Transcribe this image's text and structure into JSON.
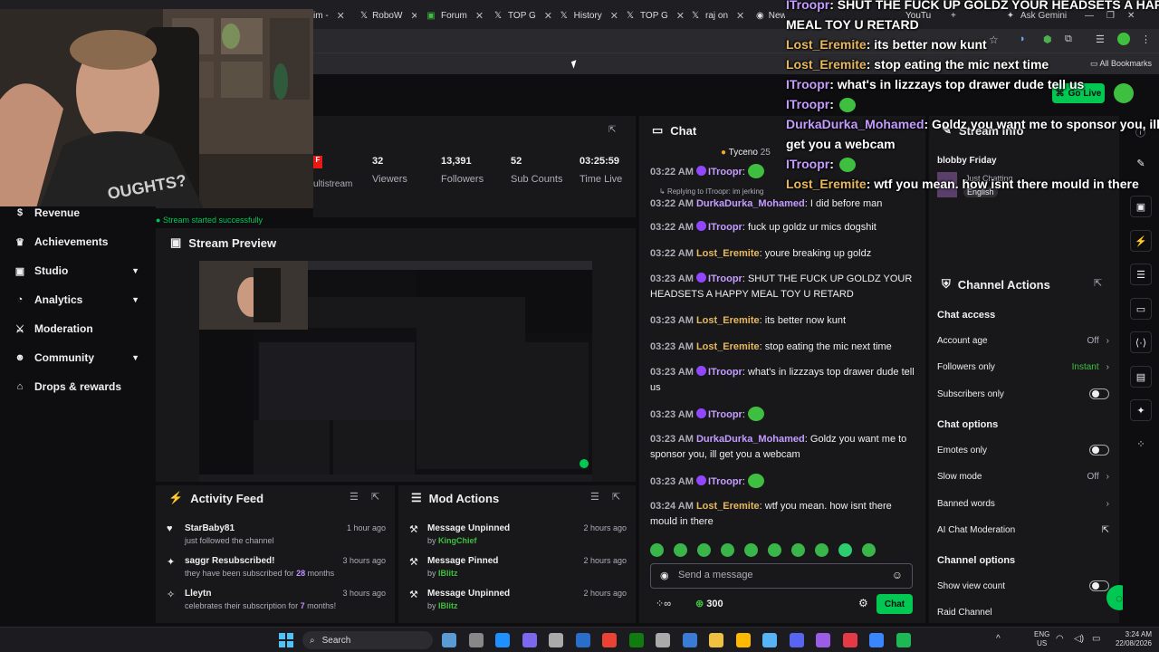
{
  "browser": {
    "tabs": [
      {
        "label": "im - "
      },
      {
        "label": "RoboW"
      },
      {
        "label": "Forum"
      },
      {
        "label": "TOP G"
      },
      {
        "label": "History"
      },
      {
        "label": "TOP G"
      },
      {
        "label": "raj on"
      },
      {
        "label": "New"
      },
      {
        "label": "YouTu"
      }
    ],
    "new_tab": "+",
    "ask_gemini": "Ask Gemini",
    "all_bookmarks": "All Bookmarks"
  },
  "header": {
    "go_live": "Go Live"
  },
  "sidebar": {
    "items": [
      {
        "label": "Revenue",
        "icon": "dollar-icon",
        "chevron": false
      },
      {
        "label": "Achievements",
        "icon": "trophy-icon",
        "chevron": false
      },
      {
        "label": "Studio",
        "icon": "studio-icon",
        "chevron": true
      },
      {
        "label": "Analytics",
        "icon": "chart-icon",
        "chevron": true
      },
      {
        "label": "Moderation",
        "icon": "sword-icon",
        "chevron": false
      },
      {
        "label": "Community",
        "icon": "community-icon",
        "chevron": true
      },
      {
        "label": "Drops & rewards",
        "icon": "gift-icon",
        "chevron": false
      }
    ]
  },
  "stats": {
    "multistream_label": "ultistream",
    "items": [
      {
        "value": "32",
        "label": "Viewers"
      },
      {
        "value": "13,391",
        "label": "Followers"
      },
      {
        "value": "52",
        "label": "Sub Counts"
      },
      {
        "value": "03:25:59",
        "label": "Time Live"
      }
    ],
    "status": "Stream started successfully"
  },
  "preview": {
    "title": "Stream Preview"
  },
  "activity": {
    "title": "Activity Feed",
    "rows": [
      {
        "title": "StarBaby81",
        "sub": "just followed the channel",
        "sub_bold": "",
        "sub_tail": "",
        "time": "1 hour ago",
        "icon": "heart-icon"
      },
      {
        "title": "saggr Resubscribed!",
        "sub": "they have been subscribed for ",
        "sub_bold": "28",
        "sub_tail": " months",
        "time": "3 hours ago",
        "icon": "star-icon"
      },
      {
        "title": "Lleytn",
        "sub": "celebrates their subscription for ",
        "sub_bold": "7",
        "sub_tail": " months!",
        "time": "3 hours ago",
        "icon": "sparkle-icon"
      }
    ]
  },
  "mod": {
    "title": "Mod Actions",
    "rows": [
      {
        "title": "Message Unpinned",
        "by": "by ",
        "user": "KingChief",
        "time": "2 hours ago"
      },
      {
        "title": "Message Pinned",
        "by": "by ",
        "user": "IBlitz",
        "time": "2 hours ago"
      },
      {
        "title": "Message Unpinned",
        "by": "by ",
        "user": "IBlitz",
        "time": "2 hours ago"
      }
    ]
  },
  "chat": {
    "title": "Chat",
    "pinned_user": "Tyceno",
    "pinned_count": "25",
    "reply_note": "Replying to ITroopr: im jerking",
    "messages": [
      {
        "time": "03:22 AM",
        "user": "ITroopr",
        "color": "#c59cff",
        "text": "",
        "emote": true
      },
      {
        "time": "03:22 AM",
        "user": "DurkaDurka_Mohamed",
        "color": "#c59cff",
        "text": "I did before man",
        "emote": false
      },
      {
        "time": "03:22 AM",
        "user": "ITroopr",
        "color": "#c59cff",
        "text": "fuck up goldz ur mics dogshit",
        "emote": false
      },
      {
        "time": "03:22 AM",
        "user": "Lost_Eremite",
        "color": "#e8b85f",
        "text": "youre breaking up goldz",
        "emote": false
      },
      {
        "time": "03:23 AM",
        "user": "ITroopr",
        "color": "#c59cff",
        "text": "SHUT THE FUCK UP GOLDZ YOUR HEADSETS A HAPPY MEAL TOY U RETARD",
        "emote": false
      },
      {
        "time": "03:23 AM",
        "user": "Lost_Eremite",
        "color": "#e8b85f",
        "text": "its better now kunt",
        "emote": false
      },
      {
        "time": "03:23 AM",
        "user": "Lost_Eremite",
        "color": "#e8b85f",
        "text": "stop eating the mic next time",
        "emote": false
      },
      {
        "time": "03:23 AM",
        "user": "ITroopr",
        "color": "#c59cff",
        "text": "what's in lizzzays top drawer dude tell us",
        "emote": false
      },
      {
        "time": "03:23 AM",
        "user": "ITroopr",
        "color": "#c59cff",
        "text": "",
        "emote": true
      },
      {
        "time": "03:23 AM",
        "user": "DurkaDurka_Mohamed",
        "color": "#c59cff",
        "text": "Goldz you want me to sponsor you, ill get you a webcam",
        "emote": false
      },
      {
        "time": "03:23 AM",
        "user": "ITroopr",
        "color": "#c59cff",
        "text": "",
        "emote": true
      },
      {
        "time": "03:24 AM",
        "user": "Lost_Eremite",
        "color": "#e8b85f",
        "text": "wtf you mean. how isnt there mould in there",
        "emote": false
      }
    ],
    "placeholder": "Send a message",
    "points": "300",
    "send_label": "Chat"
  },
  "info": {
    "title": "Stream Info",
    "stream_title": "blobby Friday",
    "category": "Just Chatting",
    "language": "English"
  },
  "actions": {
    "title": "Channel Actions",
    "chat_access": "Chat access",
    "account_age": {
      "label": "Account age",
      "value": "Off"
    },
    "followers_only": {
      "label": "Followers only",
      "value": "Instant"
    },
    "subscribers_only": {
      "label": "Subscribers only"
    },
    "chat_options": "Chat options",
    "emotes_only": {
      "label": "Emotes only"
    },
    "slow_mode": {
      "label": "Slow mode",
      "value": "Off"
    },
    "banned_words": {
      "label": "Banned words"
    },
    "ai_moderation": {
      "label": "AI Chat Moderation"
    },
    "channel_options": "Channel options",
    "show_view_count": {
      "label": "Show view count"
    },
    "raid_channel": {
      "label": "Raid Channel"
    }
  },
  "overlay": {
    "lines": [
      {
        "user": "ITroopr",
        "kind": "p",
        "text": ": SHUT THE FUCK UP GOLDZ YOUR HEADSETS A HAPPY"
      },
      {
        "user": "",
        "kind": "",
        "text": "MEAL TOY U RETARD"
      },
      {
        "user": "Lost_Eremite",
        "kind": "u",
        "text": ": its better now kunt"
      },
      {
        "user": "Lost_Eremite",
        "kind": "u",
        "text": ": stop eating the mic next time"
      },
      {
        "user": "ITroopr",
        "kind": "p",
        "text": ": what's in lizzzays top drawer dude tell us"
      },
      {
        "user": "ITroopr",
        "kind": "p",
        "text": ":"
      },
      {
        "user": "DurkaDurka_Mohamed",
        "kind": "p",
        "text": ": Goldz you want me to sponsor you, ill"
      },
      {
        "user": "",
        "kind": "",
        "text": "get you a webcam"
      },
      {
        "user": "ITroopr",
        "kind": "p",
        "text": ":"
      },
      {
        "user": "Lost_Eremite",
        "kind": "u",
        "text": ": wtf you mean. how isnt there mould in there"
      }
    ]
  },
  "taskbar": {
    "search": "Search",
    "lang": "ENG",
    "region": "US",
    "time": "3:24 AM",
    "date": "22/08/2026"
  },
  "colors": {
    "accent": "#9147ff",
    "green": "#00c853",
    "bg": "#0e0e10",
    "panel": "#18181b"
  }
}
